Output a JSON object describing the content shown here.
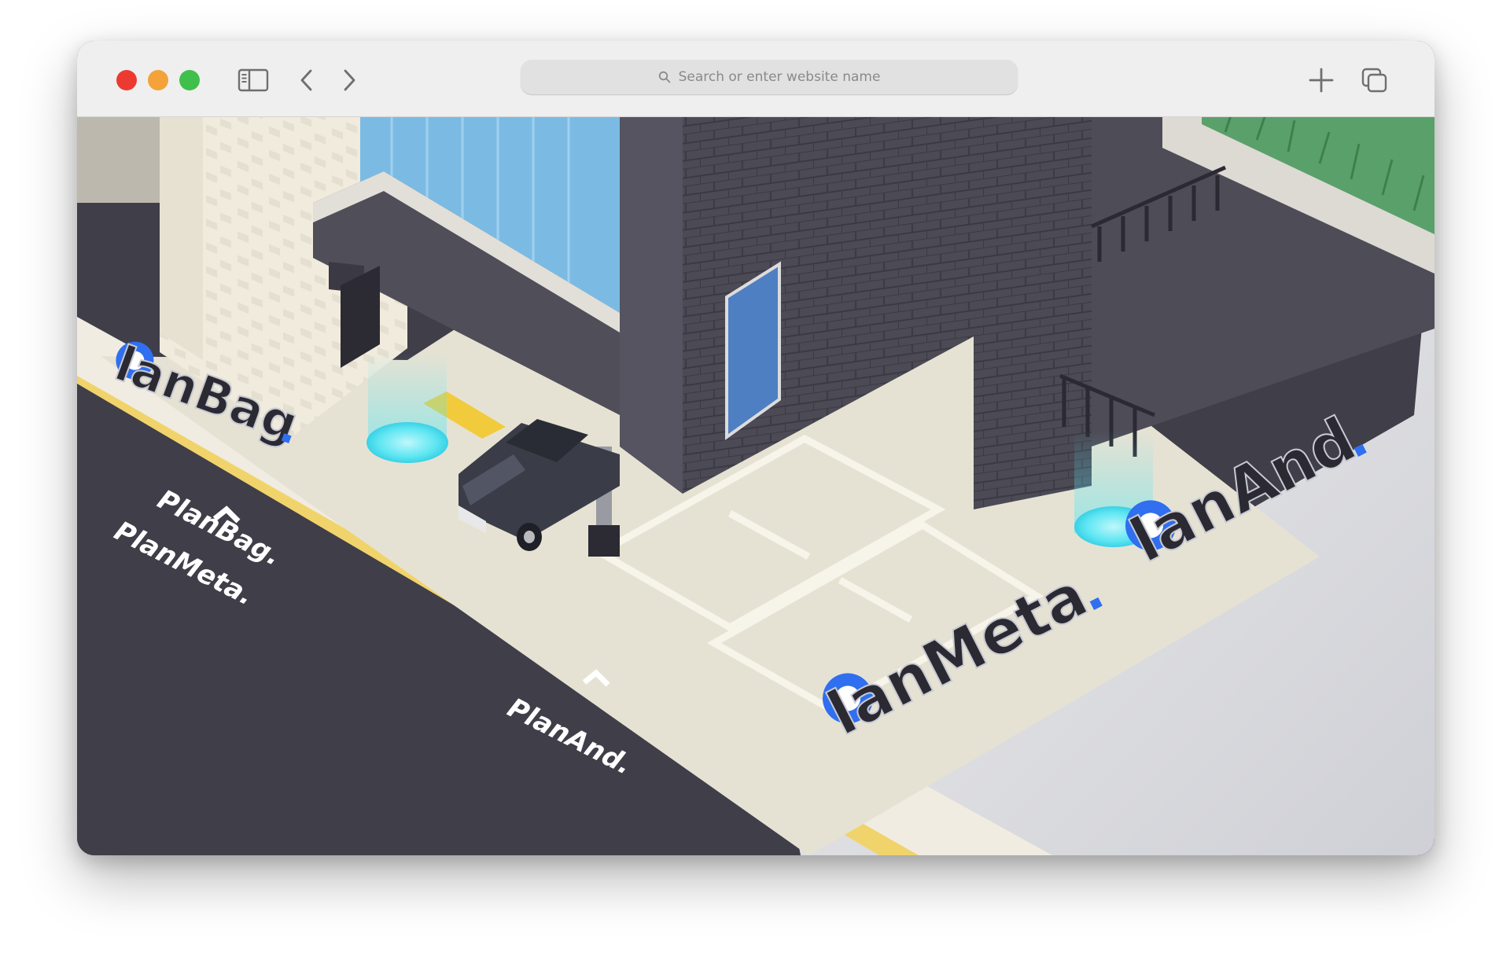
{
  "browser": {
    "address_placeholder": "Search or enter website name",
    "traffic_light_colors": {
      "close": "#ed3a31",
      "minimize": "#f3a33a",
      "zoom": "#3ec04a"
    },
    "icons": [
      "sidebar-icon",
      "back-chevron-icon",
      "forward-chevron-icon",
      "search-icon",
      "plus-icon",
      "tabs-overview-icon"
    ]
  },
  "scene": {
    "signs": {
      "planbag": {
        "brand": "PlanBag",
        "lead": "l",
        "rest": "anBag"
      },
      "planmeta": {
        "brand": "PlanMeta",
        "lead": "l",
        "rest": "anMeta"
      },
      "planand": {
        "brand": "PlanAnd",
        "lead": "l",
        "rest": "anAnd"
      }
    },
    "road_markings": {
      "planbag": "PlanBag.",
      "planmeta": "PlanMeta.",
      "planand": "PlanAnd."
    },
    "colors": {
      "brand_blue": "#2f6ff0",
      "sign_dark": "#2b2a33",
      "road": "#3f3e49",
      "pavement": "#e6e2d3",
      "portal": "#5ee6f2"
    }
  }
}
